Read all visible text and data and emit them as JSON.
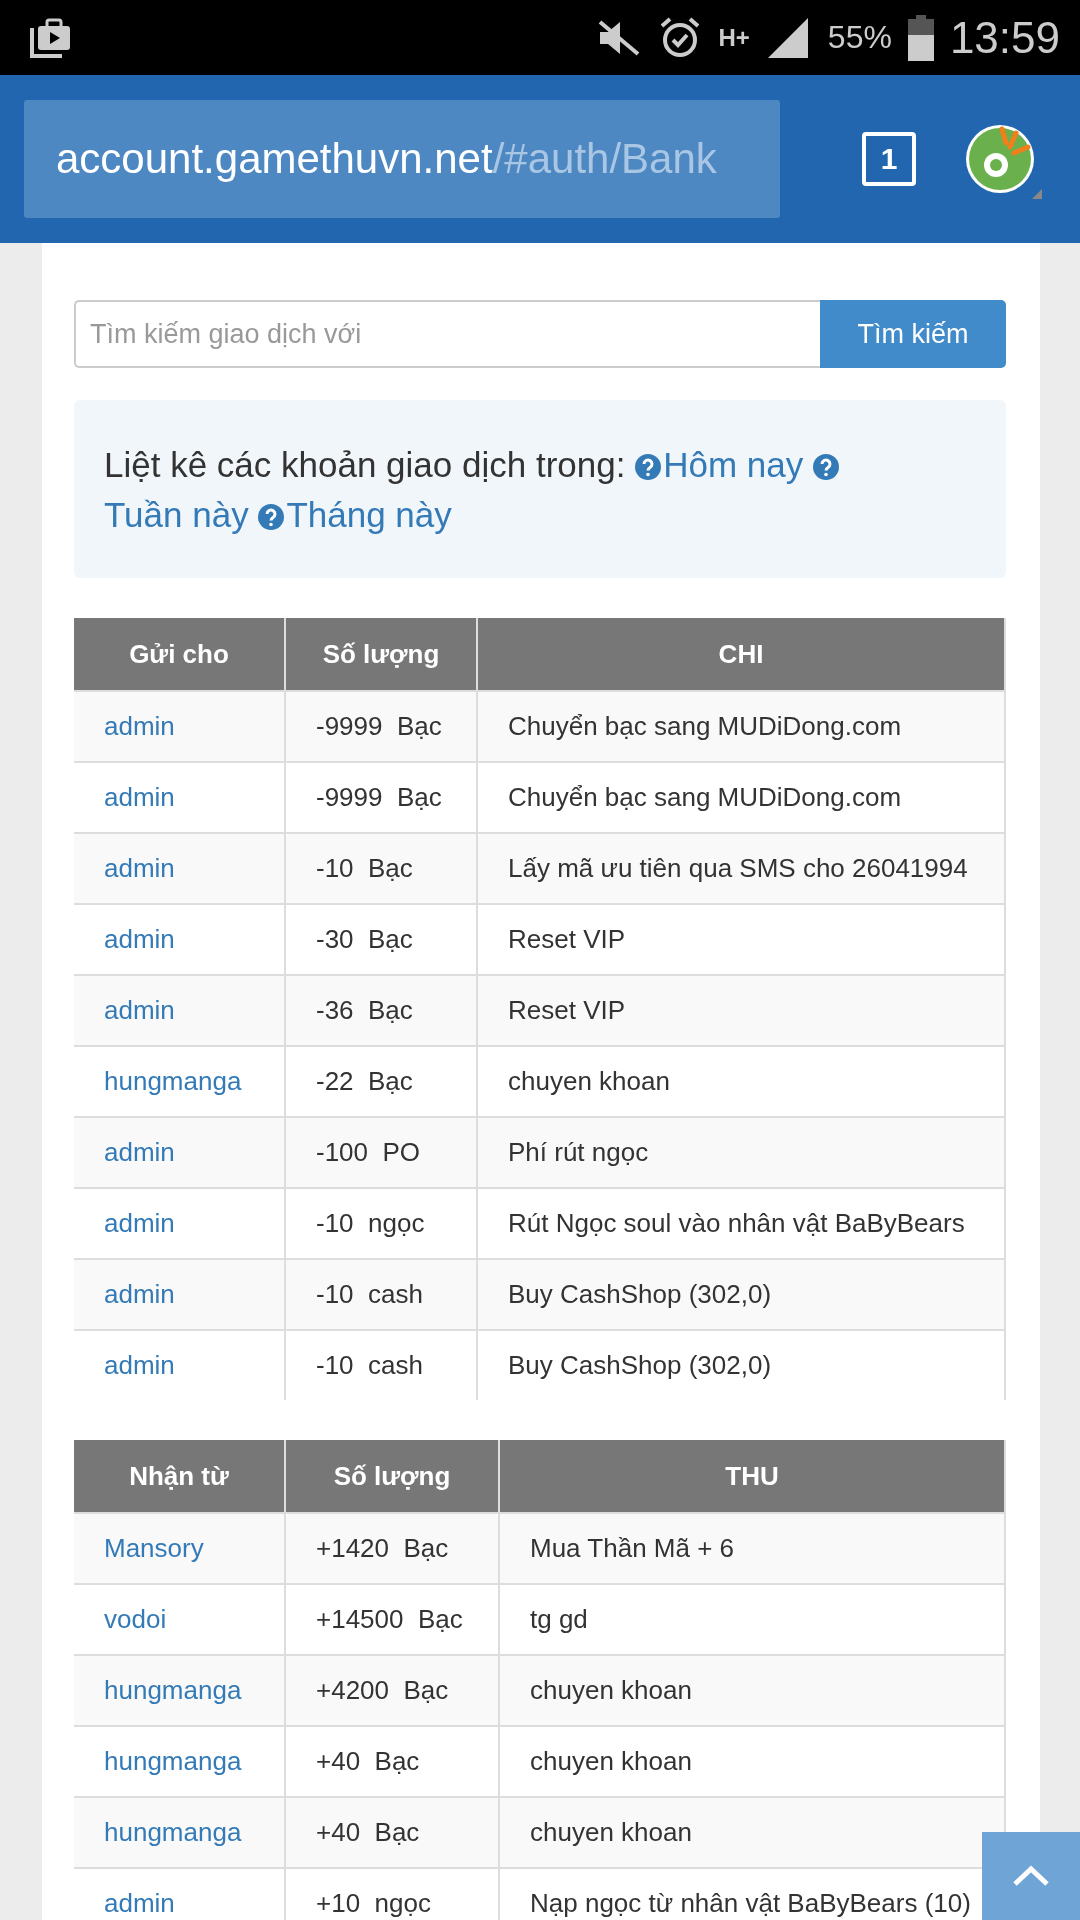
{
  "status_bar": {
    "network": "H+",
    "battery": "55%",
    "time": "13:59"
  },
  "address_bar": {
    "host": "account.gamethuvn.net",
    "path": "/#auth/Bank",
    "tab_count": "1"
  },
  "search": {
    "placeholder": "Tìm kiếm giao dịch với",
    "button": "Tìm kiếm"
  },
  "filter": {
    "label": "Liệt kê các khoản giao dịch trong:",
    "links": [
      "Hôm nay",
      "Tuần này",
      "Tháng này"
    ]
  },
  "tables": [
    {
      "columns": [
        "Gửi cho",
        "Số lượng",
        "CHI"
      ],
      "rows": [
        [
          "admin",
          "-9999  Bạc",
          "Chuyển bạc sang MUDiDong.com"
        ],
        [
          "admin",
          "-9999  Bạc",
          "Chuyển bạc sang MUDiDong.com"
        ],
        [
          "admin",
          "-10  Bạc",
          "Lấy mã ưu tiên qua SMS cho 26041994"
        ],
        [
          "admin",
          "-30  Bạc",
          "Reset VIP"
        ],
        [
          "admin",
          "-36  Bạc",
          "Reset VIP"
        ],
        [
          "hungmanga",
          "-22  Bạc",
          "chuyen khoan"
        ],
        [
          "admin",
          "-100  PO",
          "Phí rút ngọc"
        ],
        [
          "admin",
          "-10  ngọc",
          "Rút Ngọc soul vào nhân vật BaByBears"
        ],
        [
          "admin",
          "-10  cash",
          "Buy CashShop (302,0)"
        ],
        [
          "admin",
          "-10  cash",
          "Buy CashShop (302,0)"
        ]
      ]
    },
    {
      "columns": [
        "Nhận từ",
        "Số lượng",
        "THU"
      ],
      "rows": [
        [
          "Mansory",
          "+1420  Bạc",
          "Mua Thần Mã + 6"
        ],
        [
          "vodoi",
          "+14500  Bạc",
          "tg gd"
        ],
        [
          "hungmanga",
          "+4200  Bạc",
          "chuyen khoan"
        ],
        [
          "hungmanga",
          "+40  Bạc",
          "chuyen khoan"
        ],
        [
          "hungmanga",
          "+40  Bạc",
          "chuyen khoan"
        ],
        [
          "admin",
          "+10  ngọc",
          "Nạp ngọc từ nhân vật BaByBears (10)"
        ]
      ]
    }
  ]
}
